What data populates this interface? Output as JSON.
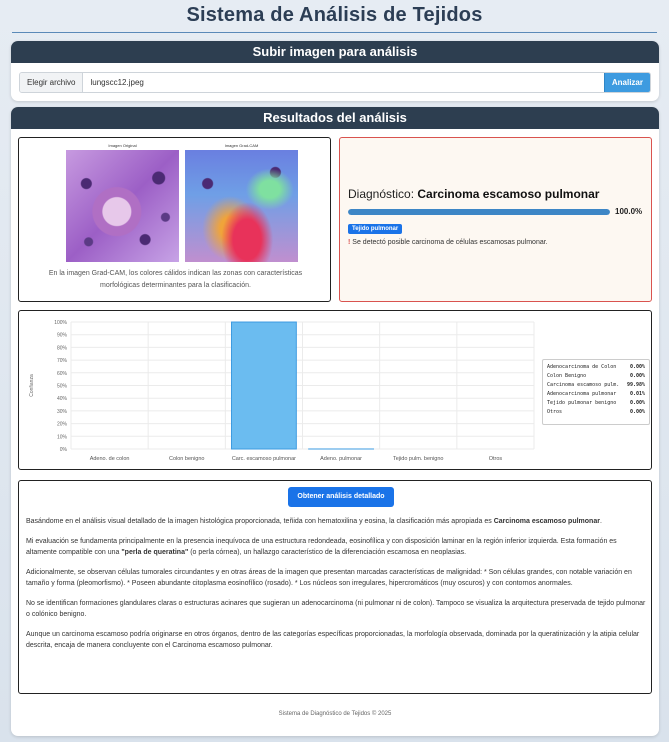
{
  "page": {
    "title": "Sistema de Análisis de Tejidos"
  },
  "upload": {
    "header": "Subir imagen para análisis",
    "choose_label": "Elegir archivo",
    "file_name": "lungscc12.jpeg",
    "analyze_label": "Analizar"
  },
  "results": {
    "header": "Resultados del análisis",
    "image_panel": {
      "original_label": "Imagen Original",
      "gradcam_label": "Imagen Grad-CAM",
      "note": "En la imagen Grad-CAM, los colores cálidos indican las zonas con características morfológicas determinantes para la clasificación."
    },
    "diagnosis": {
      "prefix": "Diagnóstico:",
      "value": "Carcinoma escamoso pulmonar",
      "confidence": 100.0,
      "confidence_label": "100.0%",
      "tag": "Tejido pulmonar",
      "warning_mark": "!",
      "warning": " Se detectó posible carcinoma de células escamosas pulmonar."
    },
    "legend": [
      {
        "label": "Adenocarcinoma de Colon",
        "value": "0.00%"
      },
      {
        "label": "Colon Benigno",
        "value": "0.00%"
      },
      {
        "label": "Carcinoma escamoso pulm.",
        "value": "99.98%"
      },
      {
        "label": "Adenocarcinoma pulmonar",
        "value": "0.01%"
      },
      {
        "label": "Tejido pulmonar benigno",
        "value": "0.00%"
      },
      {
        "label": "Otros",
        "value": "0.00%"
      }
    ],
    "detail": {
      "button": "Obtener análisis detallado",
      "p1_a": "Basándome en el análisis visual detallado de la imagen histológica proporcionada, teñida con hematoxilina y eosina, la clasificación más apropiada es ",
      "p1_b": "Carcinoma escamoso pulmonar",
      "p1_c": ".",
      "p2_a": "Mi evaluación se fundamenta principalmente en la presencia inequívoca de una estructura redondeada, eosinofílica y con disposición laminar en la región inferior izquierda. Esta formación es altamente compatible con una ",
      "p2_b": "\"perla de queratina\"",
      "p2_c": " (o perla córnea), un hallazgo característico de la diferenciación escamosa en neoplasias.",
      "p3": "Adicionalmente, se observan células tumorales circundantes y en otras áreas de la imagen que presentan marcadas características de malignidad: * Son células grandes, con notable variación en tamaño y forma (pleomorfismo). * Poseen abundante citoplasma eosinofílico (rosado). * Los núcleos son irregulares, hipercromáticos (muy oscuros) y con contornos anormales.",
      "p4": "No se identifican formaciones glandulares claras o estructuras acinares que sugieran un adenocarcinoma (ni pulmonar ni de colon). Tampoco se visualiza la arquitectura preservada de tejido pulmonar o colónico benigno.",
      "p5": "Aunque un carcinoma escamoso podría originarse en otros órganos, dentro de las categorías específicas proporcionadas, la morfología observada, dominada por la queratinización y la atipia celular descrita, encaja de manera concluyente con el Carcinoma escamoso pulmonar."
    },
    "footer": "Sistema de Diagnóstico de Tejidos © 2025"
  },
  "chart_data": {
    "type": "bar",
    "categories": [
      "Adeno. de colon",
      "Colon benigno",
      "Carc. escamoso pulmonar",
      "Adeno. pulmonar",
      "Tejido pulm. benigno",
      "Otros"
    ],
    "values": [
      0.0,
      0.0,
      99.98,
      0.01,
      0.0,
      0.0
    ],
    "ylabel": "Confianza",
    "ylim": [
      0,
      100
    ],
    "yticks": [
      "0%",
      "10%",
      "20%",
      "30%",
      "40%",
      "50%",
      "60%",
      "70%",
      "80%",
      "90%",
      "100%"
    ],
    "grid": true,
    "colors": {
      "bar_fill": "#6bbcf0",
      "bar_stroke": "#3d9be0"
    }
  }
}
